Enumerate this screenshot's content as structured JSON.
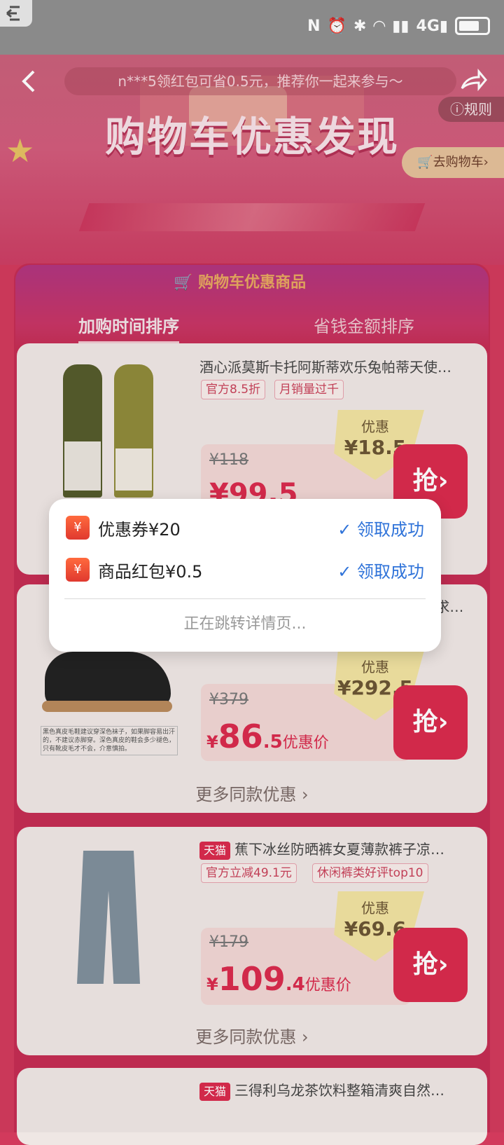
{
  "notice": "n***5领红包可省0.5元，推荐你一起来参与～",
  "rules_label": "规则",
  "go_cart_label": "去购物车",
  "banner_title": "购物车优惠发现",
  "panel_title": "购物车优惠商品",
  "tabs": [
    "加购时间排序",
    "省钱金额排序"
  ],
  "products": [
    {
      "title": "酒心派莫斯卡托阿斯蒂欢乐兔帕蒂天使…",
      "tags": [
        "官方8.5折",
        "月销量过千"
      ],
      "old_price": "¥118",
      "new_price": "¥99.5",
      "discount_label": "优惠",
      "discount": "¥18.5",
      "grab": "抢"
    },
    {
      "title": "… 求…",
      "old_price": "¥379",
      "new_price_yen": "¥",
      "new_price_int": "86",
      "new_price_dec": ".5",
      "new_price_suffix": "优惠价",
      "discount_label": "优惠",
      "discount": "¥292.5",
      "grab": "抢",
      "note": "黑色真皮毛鞋建议穿深色袜子，如果脚容易出汗的，不建议赤脚穿。深色真皮的鞋会多少褪色，只有靴皮毛才不会，介意慎拍。",
      "more": "更多同款优惠 ›"
    },
    {
      "badge": "天猫",
      "title": "蕉下冰丝防晒裤女夏薄款裤子凉…",
      "tags": [
        "官方立减49.1元",
        "休闲裤类好评top10"
      ],
      "old_price": "¥179",
      "new_price_yen": "¥",
      "new_price_int": "109",
      "new_price_dec": ".4",
      "new_price_suffix": "优惠价",
      "discount_label": "优惠",
      "discount": "¥69.6",
      "grab": "抢",
      "more": "更多同款优惠 ›"
    },
    {
      "badge": "天猫",
      "title": "三得利乌龙茶饮料整箱清爽自然…"
    }
  ],
  "modal": {
    "rows": [
      {
        "label": "优惠券¥20",
        "status": "领取成功"
      },
      {
        "label": "商品红包¥0.5",
        "status": "领取成功"
      }
    ],
    "footer": "正在跳转详情页..."
  }
}
